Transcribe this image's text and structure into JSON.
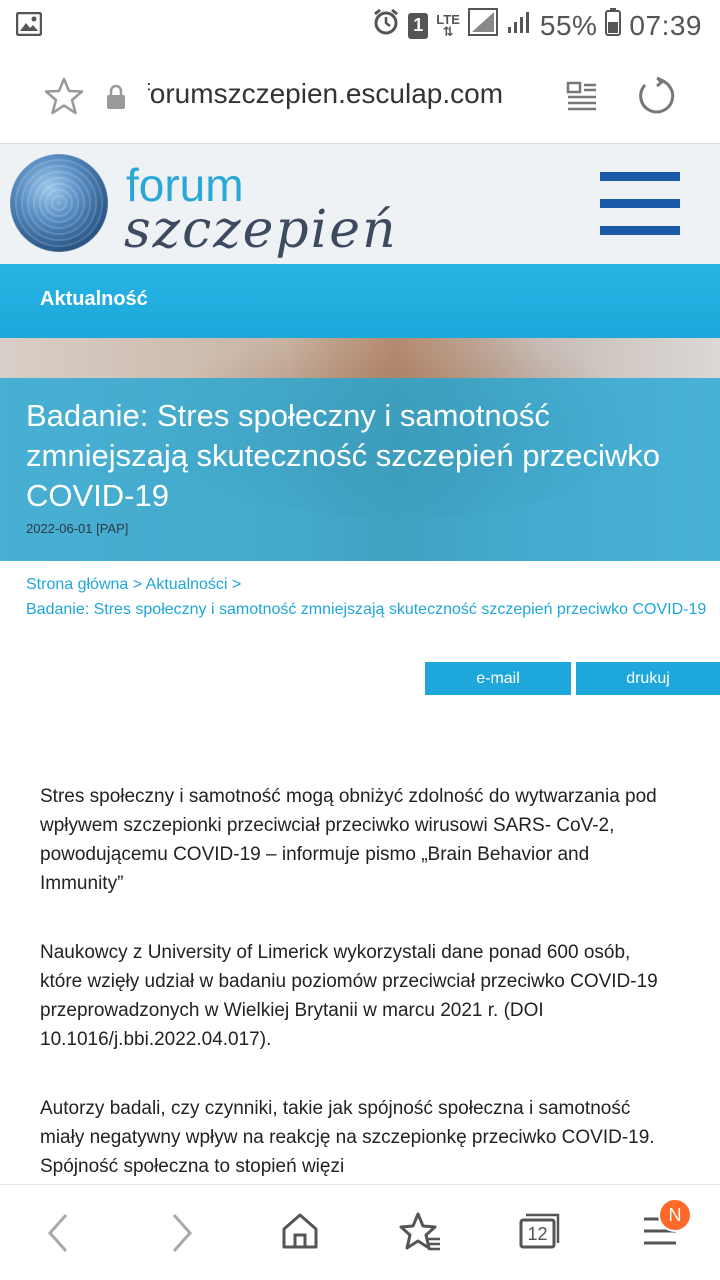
{
  "status_bar": {
    "battery": "55%",
    "time": "07:39",
    "sim": "1",
    "network": "LTE"
  },
  "browser": {
    "url": "forumszczepien.esculap.com",
    "tab_count": "12",
    "menu_badge": "N"
  },
  "site": {
    "logo_top": "forum",
    "logo_bottom": "szczepień",
    "section": "Aktualność",
    "accent_color": "#1ea7da",
    "menu_color": "#1a5aa8"
  },
  "hero": {
    "title": "Badanie: Stres społeczny i samotność zmniejszają skuteczność szczepień przeciwko COVID-19",
    "meta": "2022-06-01 [PAP]"
  },
  "breadcrumb": {
    "home": "Strona główna",
    "sep1": " > ",
    "news": "Aktualności",
    "sep2": " > ",
    "current": "Badanie: Stres społeczny i samotność zmniejszają skuteczność szczepień przeciwko COVID-19"
  },
  "actions": {
    "email": "e-mail",
    "print": "drukuj"
  },
  "article": {
    "paragraphs": [
      "Stres społeczny i samotność mogą obniżyć zdolność do wytwarzania pod wpływem szczepionki przeciwciał przeciwko wirusowi SARS- CoV-2, powodującemu COVID-19 – informuje pismo „Brain Behavior and Immunity”",
      "Naukowcy z University of Limerick wykorzystali dane ponad 600 osób, które wzięły udział w badaniu poziomów przeciwciał przeciwko COVID-19 przeprowadzonych w Wielkiej Brytanii w marcu 2021 r. (DOI 10.1016/j.bbi.2022.04.017).",
      "Autorzy badali, czy czynniki, takie jak spójność społeczna i samotność miały negatywny wpływ na reakcję na szczepionkę przeciwko COVID-19. Spójność społeczna to stopień więzi"
    ]
  }
}
